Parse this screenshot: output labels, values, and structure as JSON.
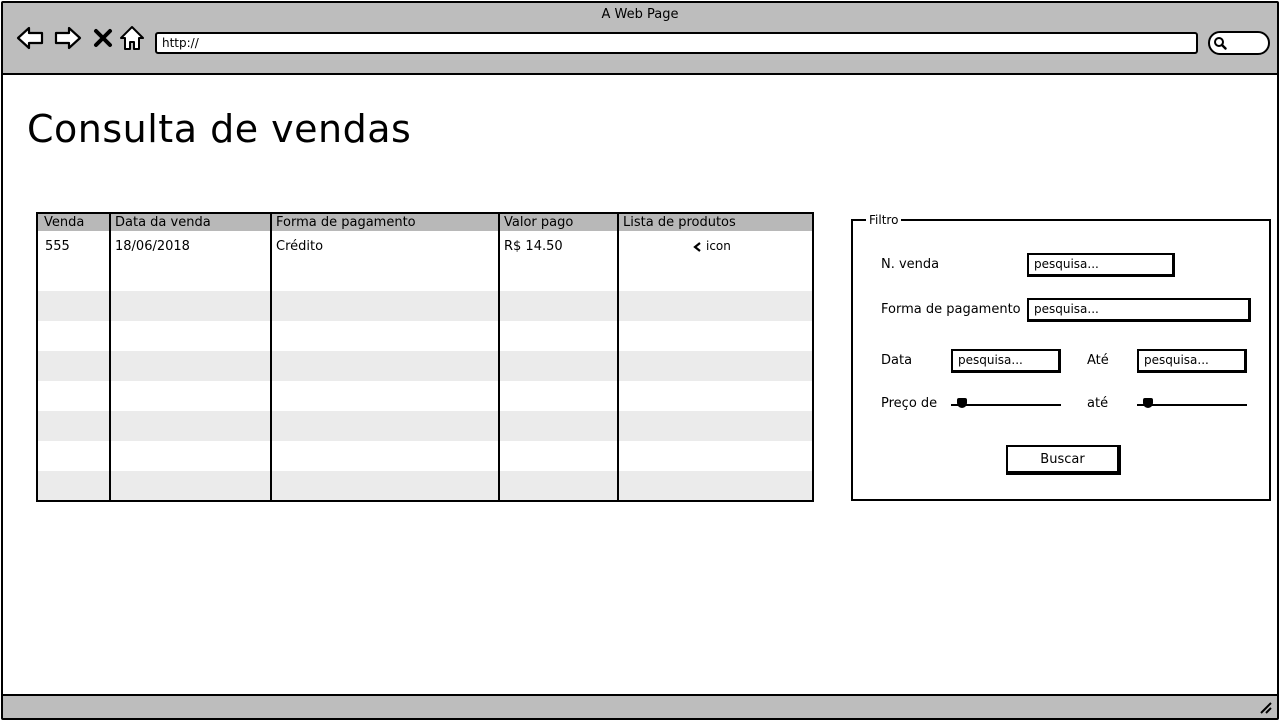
{
  "browser": {
    "window_title": "A Web Page",
    "url": "http://"
  },
  "page": {
    "title": "Consulta de vendas"
  },
  "sales_table": {
    "columns": [
      "Venda",
      "Data da venda",
      "Forma de pagamento",
      "Valor pago",
      "Lista de produtos"
    ],
    "rows": [
      {
        "venda": "555",
        "data": "18/06/2018",
        "forma": "Crédito",
        "valor": "R$ 14.50",
        "produtos": "icon"
      }
    ]
  },
  "filter": {
    "legend": "Filtro",
    "n_venda_label": "N. venda",
    "n_venda_value": "pesquisa...",
    "forma_label": "Forma de pagamento",
    "forma_value": "pesquisa...",
    "data_label": "Data",
    "data_value": "pesquisa...",
    "ate_label": "Até",
    "ate_value": "pesquisa...",
    "preco_label": "Preço de",
    "preco_ate_label": "até",
    "preco_min_level": 0.1,
    "preco_max_level": 0.1,
    "search_button": "Buscar"
  },
  "colors": {
    "chrome": "#bdbdbd",
    "table_header": "#b8b8b8",
    "row_alt": "#ebebeb"
  }
}
